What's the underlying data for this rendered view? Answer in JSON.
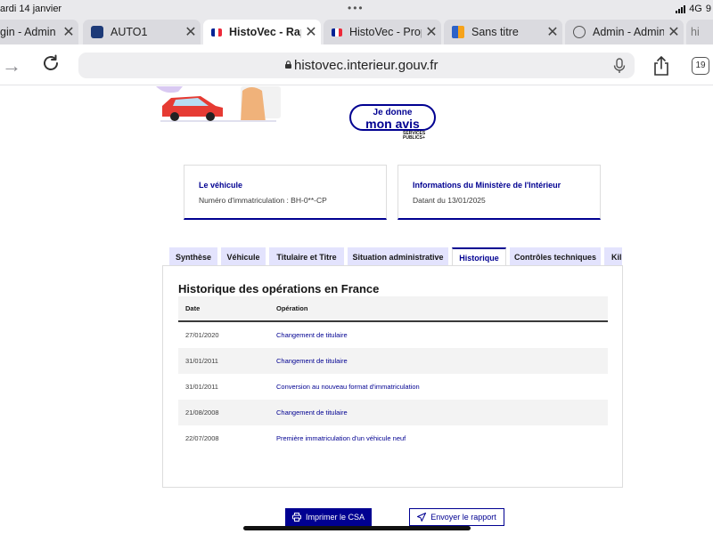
{
  "status_bar": {
    "time": "ardi 14 janvier",
    "network": "4G",
    "battery": "9"
  },
  "browser_tabs": [
    {
      "title": "gin - Admin C",
      "favicon": "orange-favicon-icon",
      "active": false
    },
    {
      "title": "AUTO1",
      "favicon": "auto1-favicon-icon",
      "active": false
    },
    {
      "title": "HistoVec - Rap",
      "favicon": "french-flag-icon",
      "active": true
    },
    {
      "title": "HistoVec - Prop",
      "favicon": "french-flag-icon",
      "active": false
    },
    {
      "title": "Sans titre",
      "favicon": "orange-favicon-icon",
      "active": false
    },
    {
      "title": "Admin - Admin",
      "favicon": "globe-icon",
      "active": false
    },
    {
      "title": "hi",
      "favicon": "tab-icon",
      "active": false
    }
  ],
  "address_bar": {
    "url": "histovec.interieur.gouv.fr",
    "tab_count": "19"
  },
  "feedback_badge": {
    "line1": "Je donne",
    "line2": "mon avis",
    "caption": "SERVICES PUBLICS+"
  },
  "vehicle_card": {
    "title": "Le véhicule",
    "text": "Numéro d'immatriculation : BH-0**-CP"
  },
  "ministry_card": {
    "title": "Informations du Ministère de l'Intérieur",
    "text": "Datant du 13/01/2025"
  },
  "content_tabs": [
    {
      "label": "Synthèse",
      "active": false
    },
    {
      "label": "Véhicule",
      "active": false
    },
    {
      "label": "Titulaire et Titre",
      "active": false
    },
    {
      "label": "Situation administrative",
      "active": false
    },
    {
      "label": "Historique",
      "active": true
    },
    {
      "label": "Contrôles techniques",
      "active": false
    },
    {
      "label": "Kil",
      "active": false
    }
  ],
  "history": {
    "title": "Historique des opérations en France",
    "columns": {
      "date": "Date",
      "operation": "Opération"
    },
    "rows": [
      {
        "date": "27/01/2020",
        "operation": "Changement de titulaire"
      },
      {
        "date": "31/01/2011",
        "operation": "Changement de titulaire"
      },
      {
        "date": "31/01/2011",
        "operation": "Conversion au nouveau format d'immatriculation"
      },
      {
        "date": "21/08/2008",
        "operation": "Changement de titulaire"
      },
      {
        "date": "22/07/2008",
        "operation": "Première immatriculation d'un véhicule neuf"
      }
    ]
  },
  "actions": {
    "print_label": "Imprimer le CSA",
    "send_label": "Envoyer le rapport"
  },
  "colors": {
    "primary": "#000091",
    "tab_background": "#e3e3fd",
    "table_stripe": "#f3f3f3"
  }
}
